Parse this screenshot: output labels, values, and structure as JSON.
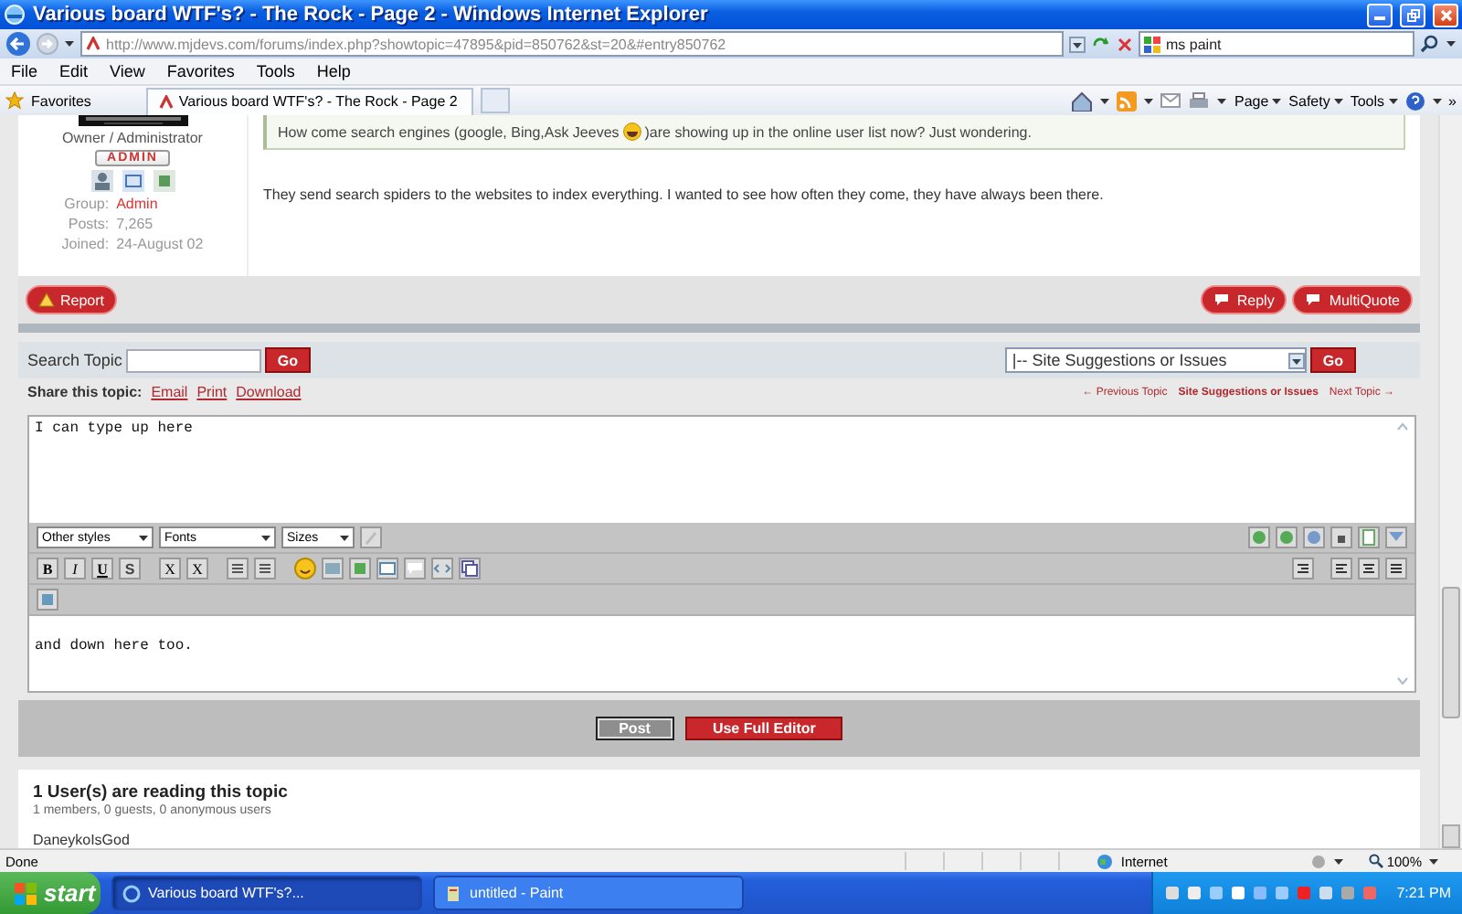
{
  "window": {
    "title": "Various board WTF's? - The Rock - Page 2 - Windows Internet Explorer"
  },
  "address": {
    "url": "http://www.mjdevs.com/forums/index.php?showtopic=47895&pid=850762&st=20&#entry850762",
    "search_value": "ms paint"
  },
  "menu": [
    "File",
    "Edit",
    "View",
    "Favorites",
    "Tools",
    "Help"
  ],
  "favorites_bar": {
    "label": "Favorites",
    "tab_title": "Various board WTF's? - The Rock - Page 2",
    "commands": [
      "Page",
      "Safety",
      "Tools"
    ],
    "more": "»"
  },
  "post": {
    "author": {
      "role": "Owner / Administrator",
      "badge": "ADMIN",
      "fields": [
        {
          "label": "Group:",
          "value": "Admin",
          "kind": "highlight"
        },
        {
          "label": "Posts:",
          "value": "7,265",
          "kind": "plain"
        },
        {
          "label": "Joined:",
          "value": "24-August 02",
          "kind": "plain"
        }
      ]
    },
    "quote_before": "How come search engines (google, Bing,Ask Jeeves",
    "quote_after": ")are showing up in the online user list now? Just wondering.",
    "reply": "They send search spiders to the websites to index everything. I wanted to see how often they come, they have always been there.",
    "buttons": [
      {
        "label": "Report",
        "kind": "report"
      },
      {
        "label": "Reply",
        "kind": "reply"
      },
      {
        "label": "MultiQuote",
        "kind": "reply"
      }
    ]
  },
  "topic_tools": {
    "search_label": "Search Topic",
    "go": "Go",
    "forum_select": "|-- Site Suggestions or Issues",
    "forum_go": "Go",
    "share_label": "Share this topic:",
    "share_links": [
      "Email",
      "Print",
      "Download"
    ],
    "nav": [
      "← Previous Topic",
      "Site Suggestions or Issues",
      "Next Topic →"
    ]
  },
  "editor": {
    "top_text": "I can type up here",
    "dropdowns": [
      "Other styles",
      "Fonts",
      "Sizes"
    ],
    "format_buttons": [
      {
        "label": "B",
        "kind": "bold"
      },
      {
        "label": "I",
        "kind": "italic"
      },
      {
        "label": "U",
        "kind": "underline"
      },
      {
        "label": "S",
        "kind": "strike"
      },
      {
        "label": "X",
        "kind": "sub"
      },
      {
        "label": "X",
        "kind": "sup"
      }
    ],
    "bottom_text": "and down here too."
  },
  "post_bar": {
    "buttons": [
      {
        "label": "Post",
        "disabled": true
      },
      {
        "label": "Use Full Editor",
        "disabled": false
      }
    ]
  },
  "readers": {
    "title": "1 User(s) are reading this topic",
    "summary": "1 members, 0 guests, 0 anonymous users",
    "users": [
      "DaneykoIsGod"
    ]
  },
  "status_bar": {
    "text": "Done",
    "zone": "Internet",
    "zoom": "100%"
  },
  "taskbar": {
    "start": "start",
    "tasks": [
      {
        "label": "Various board WTF's?...",
        "selected": true
      },
      {
        "label": "untitled - Paint",
        "selected": false
      }
    ],
    "clock": "7:21 PM"
  }
}
